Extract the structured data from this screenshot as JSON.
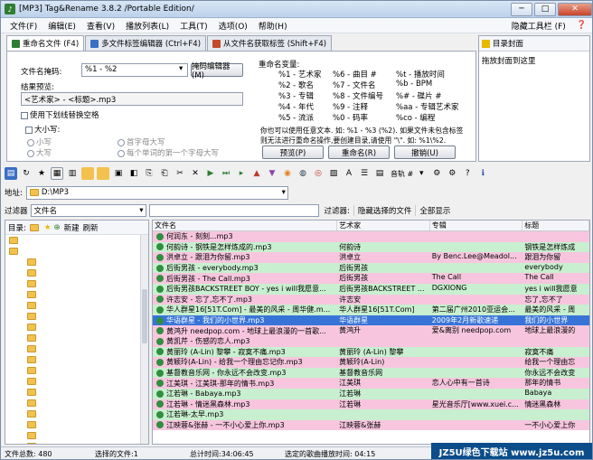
{
  "window": {
    "title": "[MP3] Tag&Rename 3.8.2 /Portable Edition/",
    "min": "─",
    "max": "□",
    "close": "✕"
  },
  "menu": {
    "items": [
      "文件(F)",
      "编辑(E)",
      "查看(V)",
      "播放列表(L)",
      "工具(T)",
      "选项(O)",
      "帮助(H)"
    ],
    "hide_toolbar": "隐藏工具栏 (F)"
  },
  "tabs": [
    "重命名文件 (F4)",
    "多文件标签编辑器 (Ctrl+F4)",
    "从文件名获取标签 (Shift+F4)"
  ],
  "right_panel": {
    "title": "目录封面",
    "text": "拖放封面到这里"
  },
  "rename": {
    "mask_label": "文件名掩码:",
    "mask_value": "%1 - %2",
    "mask_editor_button": "掩码编辑器(M)",
    "preview_label": "结果预览:",
    "preview_value": "<艺术家> - <标题>.mp3",
    "underscore_label": "使用下划线替换空格",
    "case_label": "大小写:",
    "case_options": [
      "小写",
      "首字母大写",
      "大写",
      "每个单词的第一个字母大写"
    ],
    "vars_label": "重命名变量:",
    "vars": [
      [
        "%1 - 艺术家",
        "%6 - 曲目 #",
        "%t - 播放时间"
      ],
      [
        "%2 - 歌名",
        "%7 - 文件名",
        "%b - BPM"
      ],
      [
        "%3 - 专辑",
        "%8 - 文件编号",
        "%# - 碟片 #"
      ],
      [
        "%4 - 年代",
        "%9 - 注释",
        "%aa - 专辑艺术家"
      ],
      [
        "%5 - 流派",
        "%0 - 码率",
        "%co - 编程"
      ]
    ],
    "hint1": "你也可以使用任意文本. 如: %1 - %3 (%2). 如果文件未包含标签",
    "hint2": "则无法进行重命名操作,要创建目录,请使用 \"\\\". 如: %1\\%2.",
    "preview_button": "预览(P)",
    "rename_button": "重命名(R)",
    "undo_button": "撤销(U)"
  },
  "toolbar": {
    "volume_label": "音轨 #"
  },
  "address": {
    "label": "地址:",
    "value": "D:\\MP3"
  },
  "filter": {
    "label": "过滤器",
    "field": "文件名",
    "filter_button": "过滤器:",
    "hide_button": "隐藏选择的文件",
    "show_all_button": "全部显示"
  },
  "tree": {
    "label": "目录:",
    "new_label": "新建",
    "refresh_label": "刷新",
    "items": [
      "",
      "",
      "",
      "",
      "",
      "",
      "",
      "",
      "",
      "",
      "",
      "",
      "",
      "",
      "",
      "",
      "",
      "",
      "",
      ""
    ]
  },
  "grid": {
    "headers": [
      "文件名",
      "艺术家",
      "专辑",
      "标题"
    ],
    "rows": [
      {
        "f": "何润东 - 刻刻...mp3",
        "a": "",
        "al": "",
        "t": "",
        "c": "pink"
      },
      {
        "f": "何韵诗 - 钢铁是怎样炼成的.mp3",
        "a": "何韵诗",
        "al": "",
        "t": "钢铁是怎样炼成",
        "c": "green"
      },
      {
        "f": "洪卓立 - 跟泪为你留.mp3",
        "a": "洪卓立",
        "al": "By Benc.Lee@Meadol...",
        "t": "跟泪为你留",
        "c": "pink"
      },
      {
        "f": "后街男孩 - everybody.mp3",
        "a": "后街男孩",
        "al": "",
        "t": "everybody",
        "c": "green"
      },
      {
        "f": "后街男孩 - The Call.mp3",
        "a": "后街男孩",
        "al": "The Call",
        "t": "The Call",
        "c": "pink"
      },
      {
        "f": "后街男孩BACKSTREET BOY - yes i will我愿意...",
        "a": "后街男孩BACKSTREET ...",
        "al": "DGXIONG",
        "t": "yes i will我愿意",
        "c": "green"
      },
      {
        "f": "许志安 - 忘了,忘不了.mp3",
        "a": "许志安",
        "al": "",
        "t": "忘了,忘不了",
        "c": "pink"
      },
      {
        "f": "华人群星16[51T.Com] - 最美的风采 - 周华健.m...",
        "a": "华人群星16[51T.Com]",
        "al": "第二届广州2010亚运会...",
        "t": "最美的风采 - 周",
        "c": "green"
      },
      {
        "f": "华语群星 - 我们的小世界.mp3",
        "a": "华语群星",
        "al": "2009年2月新歌速递",
        "t": "我们的小世界",
        "c": "sel"
      },
      {
        "f": "黄鸿升 needpop.com - 地球上最浪漫的一首歌...",
        "a": "黄鸿升",
        "al": "爱&离别 needpop.com",
        "t": "地球上最浪漫的",
        "c": "pink"
      },
      {
        "f": "黄凯芹 - 伤感的恋人.mp3",
        "a": "",
        "al": "",
        "t": "",
        "c": "pink"
      },
      {
        "f": "黄丽玲 (A-Lin) 黎攀 - 寂寞不痛.mp3",
        "a": "黄丽玲 (A-Lin) 黎攀",
        "al": "",
        "t": "寂寞不痛",
        "c": "green"
      },
      {
        "f": "黄颖玲(A-Lin) - 给我一个理由忘记你.mp3",
        "a": "黄颖玲(A-Lin)",
        "al": "",
        "t": "给我一个理由忘",
        "c": "pink"
      },
      {
        "f": "基督教音乐网 - 你永远不会改变.mp3",
        "a": "基督教音乐网",
        "al": "",
        "t": "你永远不会改变",
        "c": "green"
      },
      {
        "f": "江美琪 - 江美琪-那年的情书.mp3",
        "a": "江美琪",
        "al": "恋人心中有一首诗",
        "t": "那年的情书",
        "c": "pink"
      },
      {
        "f": "江若琳 - Babaya.mp3",
        "a": "江若琳",
        "al": "",
        "t": "Babaya",
        "c": "green"
      },
      {
        "f": "江若琳 - 情迷黑森林.mp3",
        "a": "江若琳",
        "al": "星光音乐厅[www.xuei.c...",
        "t": "情迷黑森林",
        "c": "pink"
      },
      {
        "f": "江若琳-太早.mp3",
        "a": "",
        "al": "",
        "t": "",
        "c": "green"
      },
      {
        "f": "江映蓉&张赫 - 一不小心爱上你.mp3",
        "a": "江映蓉&张赫",
        "al": "",
        "t": "一不小心爱上你",
        "c": "pink"
      }
    ]
  },
  "status": {
    "total": "文件总数: 480",
    "selected": "选择的文件:1",
    "total_time": "总计时间:34:06:45",
    "sel_time": "选定的歌曲播放时间: 04:15"
  },
  "watermark": "JZ5U绿色下载站 www.jz5u.com"
}
